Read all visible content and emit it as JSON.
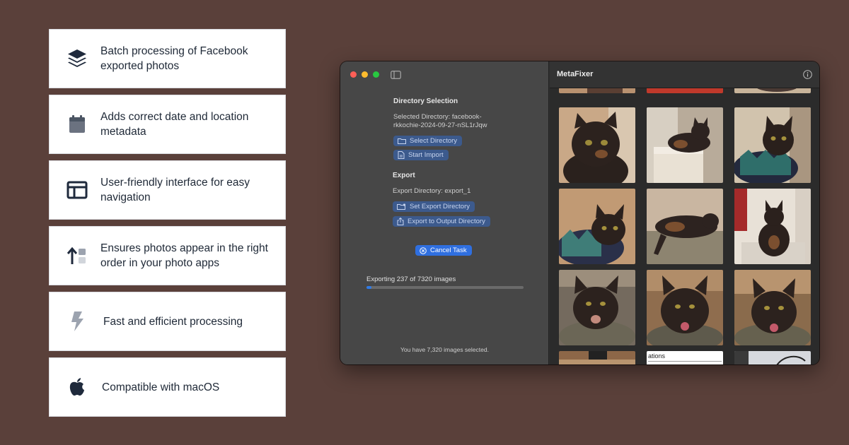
{
  "features": [
    {
      "icon": "layers-icon",
      "text": "Batch processing of Facebook exported photos"
    },
    {
      "icon": "calendar-icon",
      "text": "Adds correct date and location metadata"
    },
    {
      "icon": "layout-icon",
      "text": "User-friendly interface for easy navigation"
    },
    {
      "icon": "sort-order-icon",
      "text": "Ensures photos appear in the right order in your photo apps"
    },
    {
      "icon": "lightning-icon",
      "text": "Fast and efficient processing"
    },
    {
      "icon": "apple-icon",
      "text": "Compatible with macOS"
    }
  ],
  "window": {
    "title": "MetaFixer",
    "sidebar": {
      "directory_section": {
        "title": "Directory Selection",
        "selected_line1": "Selected Directory: facebook-",
        "selected_line2": "rkkochie-2024-09-27-nSL1rJqw",
        "select_button": "Select Directory",
        "import_button": "Start Import"
      },
      "export_section": {
        "title": "Export",
        "directory_text": "Export Directory: export_1",
        "set_button": "Set Export Directory",
        "export_button": "Export to Output Directory"
      },
      "cancel_button": "Cancel Task",
      "progress": {
        "label": "Exporting 237 of 7320 images",
        "fraction": 0.0324
      },
      "footer": "You have 7,320 images selected."
    },
    "thumbnail_caption_fragment": "ations"
  },
  "colors": {
    "background": "#5a403a",
    "accent": "#2f6fe0",
    "progress": "#2f7be8"
  }
}
